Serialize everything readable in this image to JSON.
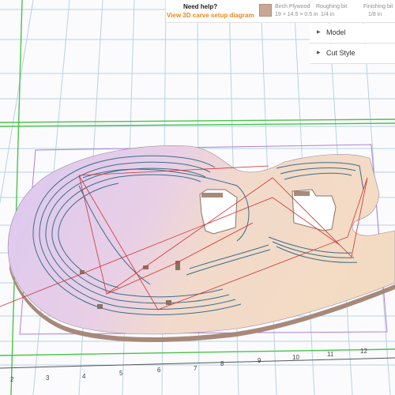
{
  "help": {
    "title": "Need help?",
    "link_label": "View 3D carve setup diagram"
  },
  "material": {
    "name": "Birch Plywood",
    "dimensions": "19 × 14.5 × 0.5 in",
    "swatch_color": "#c8a892"
  },
  "bits": {
    "roughing": {
      "label": "Roughing bit",
      "value": "1/4 in"
    },
    "finishing": {
      "label": "Finishing bit",
      "value": "1/8 in"
    }
  },
  "panels": {
    "model": {
      "label": "Model"
    },
    "cut_style": {
      "label": "Cut Style"
    }
  },
  "axis": {
    "x_ticks": [
      "2",
      "3",
      "4",
      "5",
      "6",
      "7",
      "8",
      "9",
      "10",
      "11",
      "12"
    ]
  },
  "colors": {
    "toolpath": "#3a6e8a",
    "travel": "#d33030",
    "boundary": "#49c449",
    "grid": "#b7d2e4"
  }
}
